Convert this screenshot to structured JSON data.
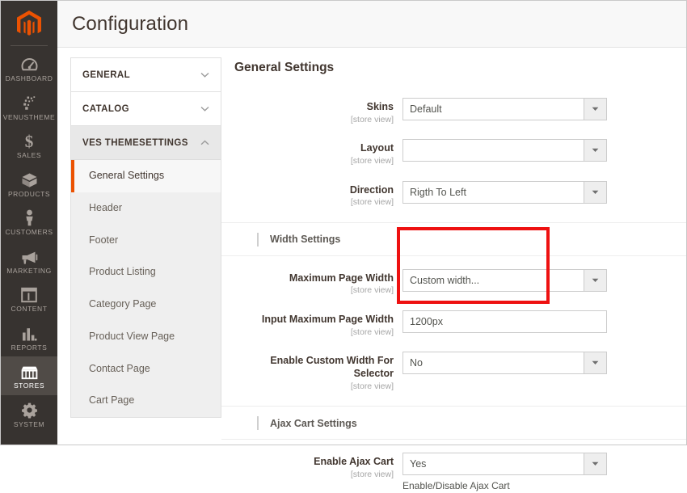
{
  "window": {
    "title": "Configuration"
  },
  "rail": {
    "logo_icon": "magento-logo-icon",
    "items": [
      {
        "label": "DASHBOARD",
        "icon": "dashboard-gauge-icon",
        "active": false
      },
      {
        "label": "VENUSTHEME",
        "icon": "venustheme-sparkle-icon",
        "active": false
      },
      {
        "label": "SALES",
        "icon": "dollar-sign-icon",
        "active": false
      },
      {
        "label": "PRODUCTS",
        "icon": "box-icon",
        "active": false
      },
      {
        "label": "CUSTOMERS",
        "icon": "person-icon",
        "active": false
      },
      {
        "label": "MARKETING",
        "icon": "megaphone-icon",
        "active": false
      },
      {
        "label": "CONTENT",
        "icon": "layout-grid-icon",
        "active": false
      },
      {
        "label": "REPORTS",
        "icon": "bar-chart-icon",
        "active": false
      },
      {
        "label": "STORES",
        "icon": "storefront-icon",
        "active": true
      },
      {
        "label": "SYSTEM",
        "icon": "gear-icon",
        "active": false
      }
    ]
  },
  "confignav": {
    "sections": [
      {
        "label": "GENERAL",
        "expanded": false,
        "chevron": "chevron-down-icon"
      },
      {
        "label": "CATALOG",
        "expanded": false,
        "chevron": "chevron-down-icon"
      },
      {
        "label": "VES THEMESETTINGS",
        "expanded": true,
        "chevron": "chevron-up-icon"
      }
    ],
    "sub_items": [
      {
        "label": "General Settings",
        "current": true
      },
      {
        "label": "Header",
        "current": false
      },
      {
        "label": "Footer",
        "current": false
      },
      {
        "label": "Product Listing",
        "current": false
      },
      {
        "label": "Category Page",
        "current": false
      },
      {
        "label": "Product View Page",
        "current": false
      },
      {
        "label": "Contact Page",
        "current": false
      },
      {
        "label": "Cart Page",
        "current": false
      }
    ]
  },
  "main": {
    "heading": "General Settings",
    "scope_note": "[store view]",
    "fields": {
      "skins": {
        "label": "Skins",
        "scope": "[store view]",
        "value": "Default",
        "caret": "caret-down-icon"
      },
      "layout": {
        "label": "Layout",
        "scope": "[store view]",
        "value": "",
        "caret": "caret-down-icon"
      },
      "direction": {
        "label": "Direction",
        "scope": "[store view]",
        "value": "Rigth To Left",
        "caret": "caret-down-icon"
      },
      "max_page_width": {
        "label": "Maximum Page Width",
        "scope": "[store view]",
        "value": "Custom width...",
        "caret": "caret-down-icon"
      },
      "input_max_page_width": {
        "label": "Input Maximum Page Width",
        "scope": "[store view]",
        "value": "1200px",
        "placeholder": ""
      },
      "enable_custom_width_selector": {
        "label": "Enable Custom Width For Selector",
        "scope": "[store view]",
        "value": "No",
        "caret": "caret-down-icon"
      },
      "enable_ajax_cart": {
        "label": "Enable Ajax Cart",
        "scope": "[store view]",
        "value": "Yes",
        "caret": "caret-down-icon",
        "note": "Enable/Disable Ajax Cart"
      }
    },
    "subheads": {
      "width_settings": "Width Settings",
      "ajax_cart_settings": "Ajax Cart Settings"
    }
  },
  "annotation": {
    "name": "red-highlight-box",
    "color": "#ee1111"
  },
  "colors": {
    "rail_bg": "#373330",
    "rail_active_bg": "#504b47",
    "magento_orange": "#eb5202",
    "header_bg": "#f8f8f8",
    "title_text": "#41362f",
    "nav_sub_bg": "#efefef",
    "border": "#cccccc",
    "annotation_red": "#ee1111"
  }
}
